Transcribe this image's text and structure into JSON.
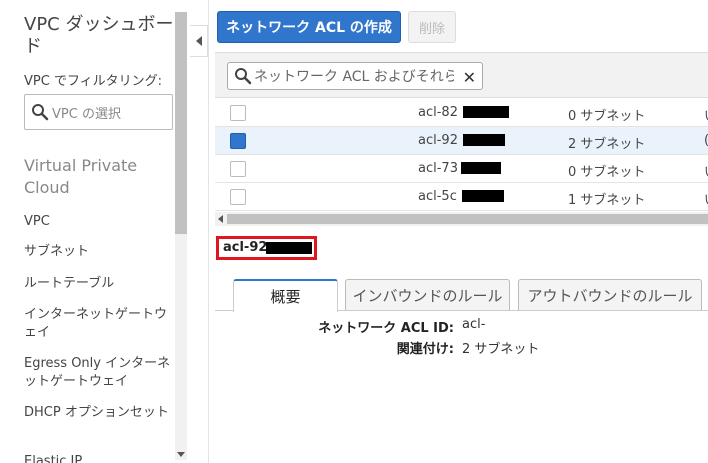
{
  "sidebar": {
    "title": "VPC ダッシュボード",
    "filter_label": "VPC でフィルタリング:",
    "select_placeholder": "VPC の選択",
    "section": "Virtual Private Cloud",
    "items": [
      {
        "label": "VPC"
      },
      {
        "label": "サブネット"
      },
      {
        "label": "ルートテーブル"
      },
      {
        "label": "インターネットゲートウェイ"
      },
      {
        "label": "Egress Only インターネットゲートウェイ"
      },
      {
        "label": "DHCP オプションセット"
      },
      {
        "label": "Elastic IP"
      }
    ]
  },
  "toolbar": {
    "create_label": "ネットワーク ACL の作成",
    "delete_label": "削除"
  },
  "search": {
    "placeholder": "ネットワーク ACL およびそれらのプロパティでフィルタリング"
  },
  "table": {
    "rows": [
      {
        "id": "acl-82",
        "subnets": "0 サブネット",
        "extra": "い",
        "selected": false
      },
      {
        "id": "acl-92",
        "subnets": "2 サブネット",
        "extra": "(",
        "selected": true
      },
      {
        "id": "acl-73",
        "subnets": "0 サブネット",
        "extra": "い",
        "selected": false
      },
      {
        "id": "acl-5c",
        "subnets": "1 サブネット",
        "extra": "い",
        "selected": false
      }
    ]
  },
  "details": {
    "selected_id": "acl-92",
    "tabs": [
      {
        "label": "概要",
        "active": true
      },
      {
        "label": "インバウンドのルール",
        "active": false
      },
      {
        "label": "アウトバウンドのルール",
        "active": false
      }
    ],
    "fields": [
      {
        "key": "ネットワーク ACL ID:",
        "value": "acl-"
      },
      {
        "key": "関連付け:",
        "value": "2 サブネット"
      }
    ]
  },
  "colors": {
    "primary": "#2f76cc",
    "highlight": "#e0161e",
    "selected_row": "#eaf2fb"
  }
}
